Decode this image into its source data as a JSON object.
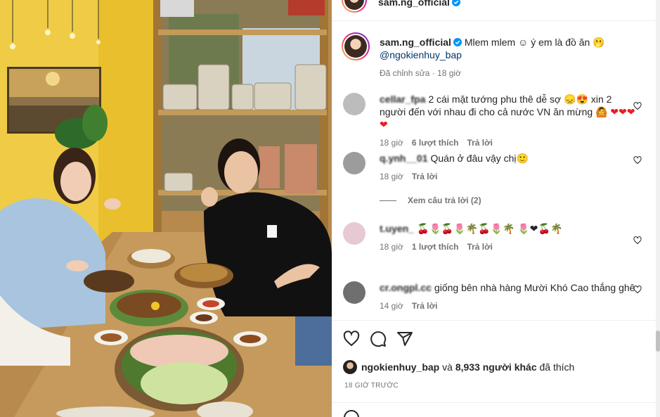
{
  "header": {
    "username": "sam.ng_official"
  },
  "caption": {
    "username": "sam.ng_official",
    "message": "Mlem mlem ☺ ý em là đồ ăn 🫢",
    "mention": "@ngokienhuy_bap",
    "meta": "Đã chỉnh sửa · 18 giờ"
  },
  "comments": [
    {
      "username": "cellar_fpa",
      "text": "2 cái mặt tướng phu thê dễ sợ 😞😍 xin 2 người đến với nhau đi cho cả nước VN ăn mừng 🙆",
      "hearts": "❤❤❤❤",
      "time": "18 giờ",
      "likes": "6 lượt thích",
      "reply": "Trả lời"
    },
    {
      "username": "q.ynh__01",
      "text": "Quán ở đâu vậy chị🙂",
      "time": "18 giờ",
      "reply": "Trả lời"
    },
    {
      "username": "t.uyen_",
      "text": "🍒🌷🍒🌷🌴🍒🌷🌴 🌷❤🍒🌴",
      "time": "18 giờ",
      "likes": "1 lượt thích",
      "reply": "Trả lời"
    },
    {
      "username": "cr.ongpl.cc",
      "text": "giống bên nhà hàng Mười Khó Cao thắng ghê",
      "time": "14 giờ",
      "reply": "Trả lời"
    }
  ],
  "view_replies": "Xem câu trả lời (2)",
  "likes": {
    "user": "ngokienhuy_bap",
    "connector": "và",
    "others": "8,933 người khác",
    "suffix": "đã thích"
  },
  "timestamp": "18 GIỜ TRƯỚC",
  "colors": {
    "link": "#00376b",
    "muted": "#737373",
    "verified": "#0095f6",
    "heart": "#ed1c24",
    "wall_yellow": "#e8c341"
  },
  "icons": [
    "heart-icon",
    "comment-icon",
    "share-icon",
    "save-icon",
    "verified-icon"
  ]
}
